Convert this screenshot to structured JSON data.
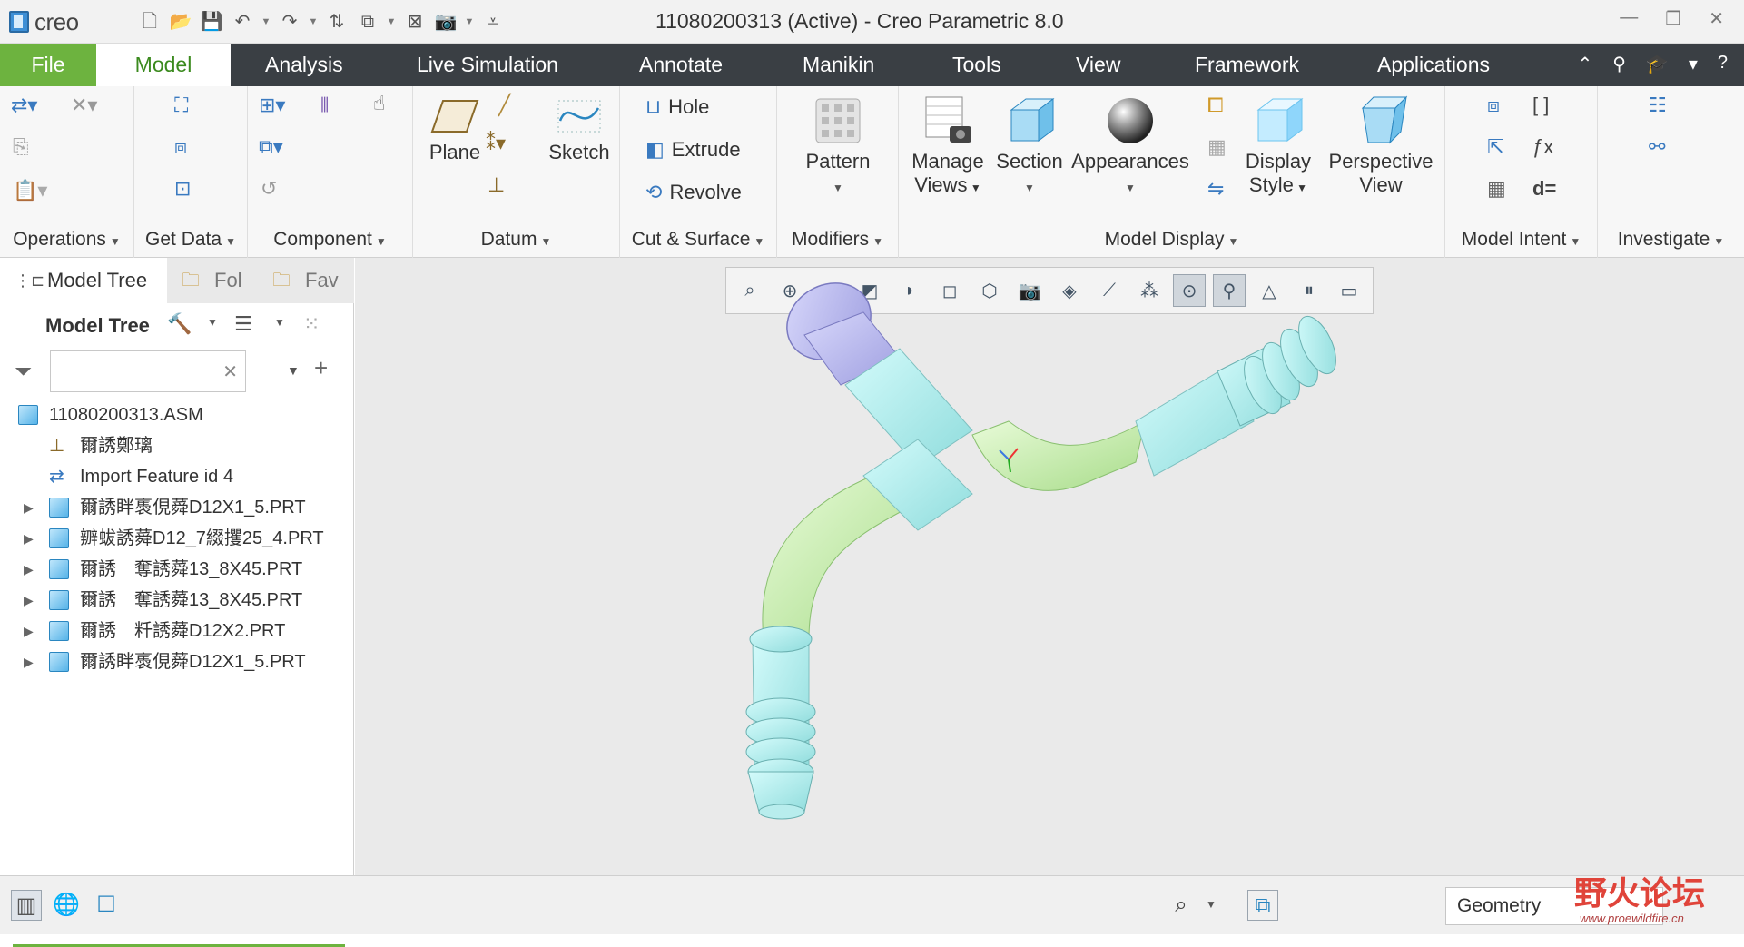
{
  "app": {
    "logo_text": "creo",
    "title": "11080200313 (Active) - Creo Parametric 8.0"
  },
  "tabs": {
    "file": "File",
    "model": "Model",
    "analysis": "Analysis",
    "live_simulation": "Live Simulation",
    "annotate": "Annotate",
    "manikin": "Manikin",
    "tools": "Tools",
    "view": "View",
    "framework": "Framework",
    "applications": "Applications"
  },
  "ribbon": {
    "groups": {
      "operations": "Operations",
      "get_data": "Get Data",
      "component": "Component",
      "datum": "Datum",
      "cut_surface": "Cut & Surface",
      "modifiers": "Modifiers",
      "model_display": "Model Display",
      "model_intent": "Model Intent",
      "investigate": "Investigate"
    },
    "buttons": {
      "plane": "Plane",
      "sketch": "Sketch",
      "hole": "Hole",
      "extrude": "Extrude",
      "revolve": "Revolve",
      "pattern": "Pattern",
      "manage_views_1": "Manage",
      "manage_views_2": "Views",
      "section": "Section",
      "appearances": "Appearances",
      "display_style_1": "Display",
      "display_style_2": "Style",
      "perspective_view_1": "Perspective",
      "perspective_view_2": "View"
    }
  },
  "panel": {
    "tabs": [
      "Model Tree",
      "Fol",
      "Fav"
    ],
    "header": "Model Tree",
    "search_value": "",
    "tree": [
      {
        "label": "11080200313.ASM",
        "type": "asm",
        "expandable": false
      },
      {
        "label": "爾誘鄭璃",
        "type": "csys",
        "expandable": false
      },
      {
        "label": "Import Feature id 4",
        "type": "import",
        "expandable": false
      },
      {
        "label": "爾誘眫褭俔蕣D12X1_5.PRT",
        "type": "part",
        "expandable": true
      },
      {
        "label": "辧蛂誘蕣D12_7綴攫25_4.PRT",
        "type": "part",
        "expandable": true
      },
      {
        "label": "爾誘　奪誘蕣13_8X45.PRT",
        "type": "part",
        "expandable": true
      },
      {
        "label": "爾誘　奪誘蕣13_8X45.PRT",
        "type": "part",
        "expandable": true
      },
      {
        "label": "爾誘　粁誘蕣D12X2.PRT",
        "type": "part",
        "expandable": true
      },
      {
        "label": "爾誘眫褭俔蕣D12X1_5.PRT",
        "type": "part",
        "expandable": true
      }
    ]
  },
  "status": {
    "filter_value": "Geometry"
  },
  "watermark": {
    "text": "野火论坛",
    "url": "www.proewildfire.cn"
  }
}
